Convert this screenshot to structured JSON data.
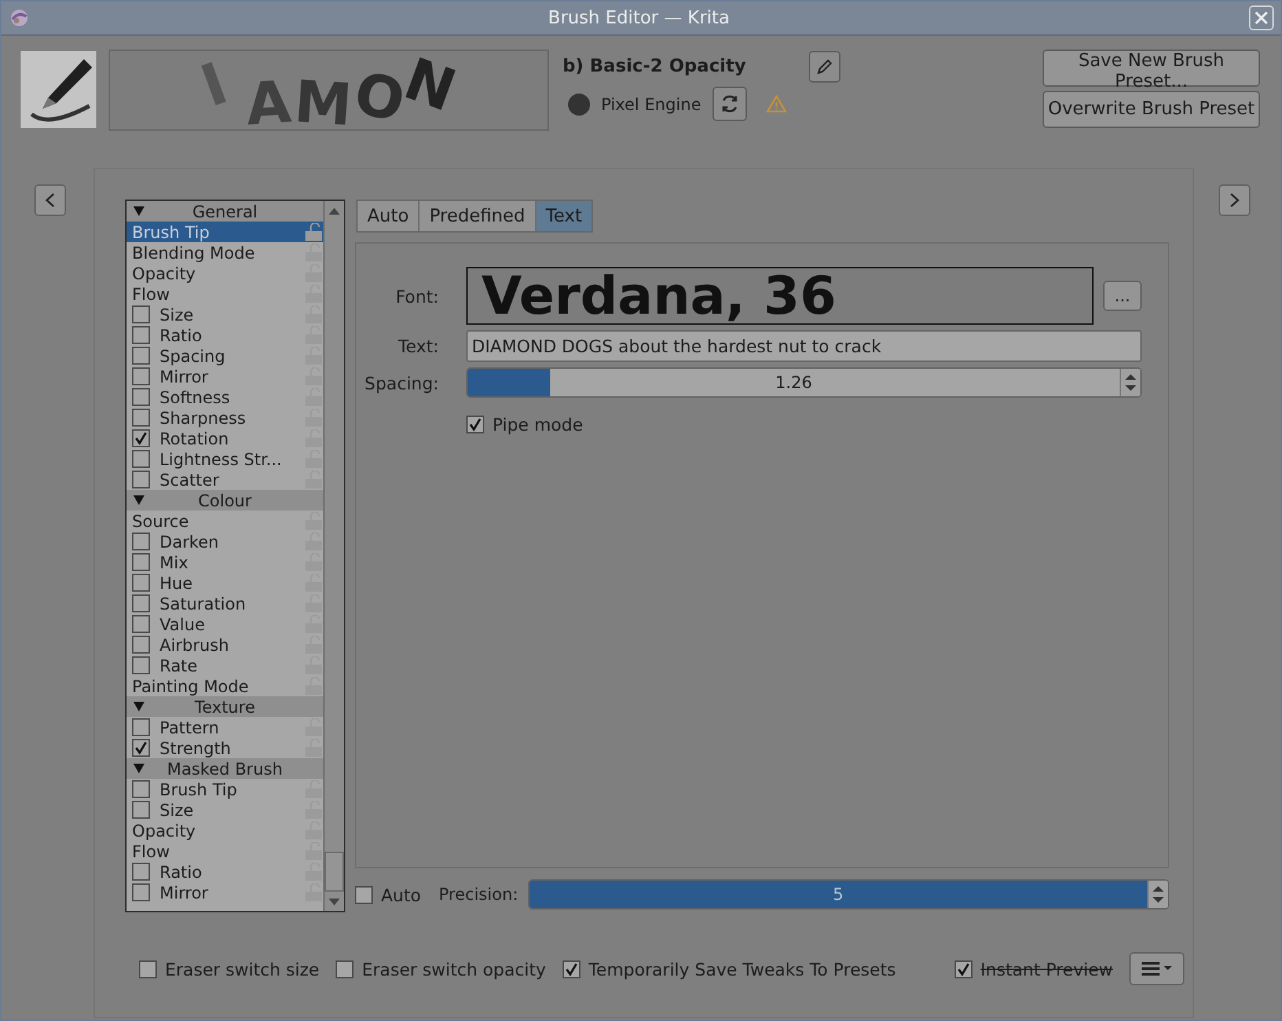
{
  "window": {
    "title": "Brush Editor — Krita"
  },
  "preset": {
    "name": "b) Basic-2 Opacity",
    "engine": "Pixel Engine",
    "preview_text": "I AMON",
    "warning": true
  },
  "header_buttons": [
    "Save New Brush Preset...",
    "Overwrite Brush Preset"
  ],
  "options": [
    {
      "kind": "header",
      "label": "General",
      "expanded": true
    },
    {
      "kind": "plain",
      "label": "Brush Tip",
      "selected": true
    },
    {
      "kind": "plain",
      "label": "Blending Mode",
      "selected": false
    },
    {
      "kind": "plain",
      "label": "Opacity",
      "selected": false
    },
    {
      "kind": "plain",
      "label": "Flow",
      "selected": false
    },
    {
      "kind": "check",
      "label": "Size",
      "checked": false,
      "selected": false
    },
    {
      "kind": "check",
      "label": "Ratio",
      "checked": false,
      "selected": false
    },
    {
      "kind": "check",
      "label": "Spacing",
      "checked": false,
      "selected": false
    },
    {
      "kind": "check",
      "label": "Mirror",
      "checked": false,
      "selected": false
    },
    {
      "kind": "check",
      "label": "Softness",
      "checked": false,
      "selected": false
    },
    {
      "kind": "check",
      "label": "Sharpness",
      "checked": false,
      "selected": false
    },
    {
      "kind": "check",
      "label": "Rotation",
      "checked": true,
      "selected": false
    },
    {
      "kind": "check",
      "label": "Lightness Str...",
      "checked": false,
      "selected": false
    },
    {
      "kind": "check",
      "label": "Scatter",
      "checked": false,
      "selected": false
    },
    {
      "kind": "header",
      "label": "Colour",
      "expanded": true
    },
    {
      "kind": "plain",
      "label": "Source",
      "selected": false
    },
    {
      "kind": "check",
      "label": "Darken",
      "checked": false,
      "selected": false
    },
    {
      "kind": "check",
      "label": "Mix",
      "checked": false,
      "selected": false
    },
    {
      "kind": "check",
      "label": "Hue",
      "checked": false,
      "selected": false
    },
    {
      "kind": "check",
      "label": "Saturation",
      "checked": false,
      "selected": false
    },
    {
      "kind": "check",
      "label": "Value",
      "checked": false,
      "selected": false
    },
    {
      "kind": "check",
      "label": "Airbrush",
      "checked": false,
      "selected": false
    },
    {
      "kind": "check",
      "label": "Rate",
      "checked": false,
      "selected": false
    },
    {
      "kind": "plain",
      "label": "Painting Mode",
      "selected": false
    },
    {
      "kind": "header",
      "label": "Texture",
      "expanded": true
    },
    {
      "kind": "check",
      "label": "Pattern",
      "checked": false,
      "selected": false
    },
    {
      "kind": "check",
      "label": "Strength",
      "checked": true,
      "selected": false
    },
    {
      "kind": "header",
      "label": "Masked Brush",
      "expanded": true
    },
    {
      "kind": "check",
      "label": "Brush Tip",
      "checked": false,
      "selected": false
    },
    {
      "kind": "check",
      "label": "Size",
      "checked": false,
      "selected": false
    },
    {
      "kind": "plain",
      "label": "Opacity",
      "selected": false
    },
    {
      "kind": "plain",
      "label": "Flow",
      "selected": false
    },
    {
      "kind": "check",
      "label": "Ratio",
      "checked": false,
      "selected": false
    },
    {
      "kind": "check",
      "label": "Mirror",
      "checked": false,
      "selected": false
    }
  ],
  "brush_tip_tabs": [
    {
      "label": "Auto",
      "selected": false
    },
    {
      "label": "Predefined",
      "selected": false
    },
    {
      "label": "Text",
      "selected": true
    }
  ],
  "text_tip": {
    "font_label": "Font:",
    "font_value": "Verdana, 36",
    "font_button": "...",
    "text_label": "Text:",
    "text_value": "DIAMOND DOGS about the hardest nut to crack",
    "spacing_label": "Spacing:",
    "spacing": {
      "reading": "1.26",
      "level": 0.126
    },
    "pipe_mode": {
      "label": "Pipe mode",
      "checked": true
    }
  },
  "precision": {
    "auto": {
      "label": "Auto",
      "checked": false
    },
    "label": "Precision:",
    "reading": "5",
    "level": 1.0
  },
  "footer": {
    "options": [
      {
        "label": "Eraser switch size",
        "checked": false,
        "struck": false
      },
      {
        "label": "Eraser switch opacity",
        "checked": false,
        "struck": false
      },
      {
        "label": "Temporarily Save Tweaks To Presets",
        "checked": true,
        "struck": false
      },
      {
        "label": "Instant Preview",
        "checked": true,
        "struck": true
      }
    ]
  }
}
